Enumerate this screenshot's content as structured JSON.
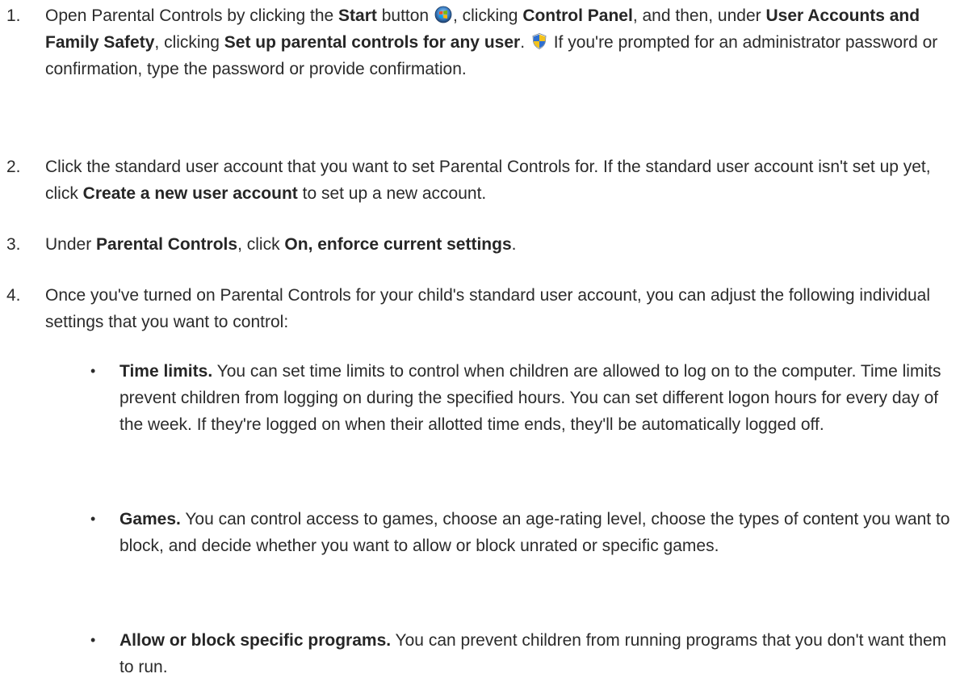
{
  "steps": [
    {
      "number": "1.",
      "t1": "Open Parental Controls by clicking the ",
      "b1": "Start",
      "t2": " button ",
      "start_icon": "windows-start-orb-icon",
      "t3": ", clicking ",
      "b2": "Control Panel",
      "t4": ", and then, under ",
      "b3": "User Accounts and Family Safety",
      "t5": ", clicking ",
      "b4": "Set up parental controls for any user",
      "t6": ". ",
      "shield_icon": "uac-shield-icon",
      "t7": " If you're prompted for an administrator password or confirmation, type the password or provide confirmation."
    },
    {
      "number": "2.",
      "t1": "Click the standard user account that you want to set Parental Controls for. If the standard user account isn't set up yet, click ",
      "b1": "Create a new user account",
      "t2": " to set up a new account."
    },
    {
      "number": "3.",
      "t1": "Under ",
      "b1": "Parental Controls",
      "t2": ", click ",
      "b2": "On, enforce current settings",
      "t3": "."
    },
    {
      "number": "4.",
      "t1": "Once you've turned on Parental Controls for your child's standard user account, you can adjust the following individual settings that you want to control:"
    }
  ],
  "bullets": [
    {
      "symbol": "•",
      "bold": "Time limits.",
      "text": " You can set time limits to control when children are allowed to log on to the computer. Time limits prevent children from logging on during the specified hours. You can set different logon hours for every day of the week. If they're logged on when their allotted time ends, they'll be automatically logged off."
    },
    {
      "symbol": "•",
      "bold": "Games.",
      "text": " You can control access to games, choose an age-rating level, choose the types of content you want to block, and decide whether you want to allow or block unrated or specific games."
    },
    {
      "symbol": "•",
      "bold": "Allow or block specific programs.",
      "text": " You can prevent children from running programs that you don't want them to run."
    }
  ]
}
